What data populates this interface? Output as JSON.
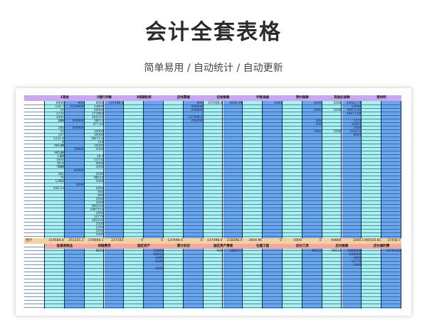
{
  "page": {
    "title": "会计全套表格",
    "subtitle": "简单易用 / 自动统计 / 自动更新"
  },
  "sheet": {
    "headers": [
      "1现金",
      "2银行存款",
      "3短期投资",
      "应收票据",
      "应收账款",
      "坏帐准备",
      "预付账款",
      "其他应收款",
      "原材料"
    ],
    "total_label": "合计",
    "totals": [
      "119584.8",
      "251331.1",
      "579006.1",
      "237193",
      "0",
      "0",
      "137498.4",
      "0",
      "137498.4",
      "218398.4",
      "2604.96",
      "0",
      "5000",
      "0",
      "40800",
      "1000",
      "1785545.81",
      "37458.7"
    ],
    "headers2": [
      "低值易耗品",
      "待摊费用",
      "固定资产",
      "累计折旧",
      "固定资产清理",
      "在建工程",
      "应付工资",
      "应付账款",
      "应付福利费"
    ],
    "col_values": {
      "c1": [
        "6000",
        "126.7",
        "",
        "3720",
        "",
        "200",
        "",
        "180",
        "",
        "",
        "1231.4",
        "8",
        "98531",
        "",
        "98533",
        "13.5",
        "1000",
        "",
        "7647",
        "",
        "",
        "",
        "126.7",
        "",
        "",
        "",
        "",
        "",
        "",
        "",
        "",
        "",
        "",
        ""
      ],
      "c2": [
        "",
        "",
        "20",
        "",
        "2000",
        "132",
        "",
        "",
        "50",
        "147",
        "",
        "",
        "30",
        "",
        "20",
        "80",
        "",
        "69.8",
        "500",
        "",
        "281",
        "76",
        "42",
        "",
        "206.53"
      ],
      "c3": [
        "900",
        "2500000",
        "",
        "",
        "",
        "200000",
        "",
        "300000",
        "",
        "",
        "",
        "",
        "",
        "20000",
        "",
        "",
        "",
        "",
        "",
        "80000",
        "",
        "",
        "",
        "3000"
      ],
      "c4": [
        "6000",
        "13800",
        "50900",
        "273860",
        "160375",
        "18672",
        "477.43",
        "",
        "10000",
        "10000",
        "18471.6",
        "144",
        "10000",
        "5500",
        "",
        "16.4",
        "13750",
        "4600",
        "3000",
        "",
        "2000",
        "98510",
        "5000",
        "",
        "2000",
        "660",
        "660",
        "2600",
        "2600",
        "883550",
        "1897155",
        "2400",
        "14770",
        "285250",
        "2500",
        "1200",
        "5500",
        "1000",
        "1200",
        "2251785",
        "200050",
        "206.13",
        "2172",
        "47974.68"
      ],
      "c5": [
        "137498.4"
      ],
      "c6": [
        "900",
        "300000",
        "200000",
        "",
        "137498.4",
        "200000"
      ],
      "c7": [
        "137498.4"
      ],
      "c8": [
        "2604.96"
      ],
      "c9": [
        "5000"
      ],
      "c10": [
        "2000",
        "",
        "2000",
        "",
        "",
        "500",
        "200",
        "",
        "1000"
      ],
      "c11": [
        "1000",
        "",
        "1000",
        "",
        "",
        "",
        "",
        "",
        "1000"
      ],
      "c12": [
        "23042.73",
        "14000",
        "76971.05",
        "18471.60",
        "",
        "1155",
        "10855",
        "2000",
        "351672",
        "9065"
      ]
    },
    "col_values2": {
      "c3": [
        "8001"
      ],
      "c4": [
        "13800",
        "40000",
        "2400",
        "2600",
        "",
        "1200"
      ],
      "c5": [
        "900"
      ],
      "c6": [
        "18823.7"
      ],
      "c9": [
        "98531"
      ],
      "c10": [
        "98533"
      ],
      "c11": [
        "1000000",
        "500000",
        "2600",
        "14775",
        "1000"
      ],
      "c12": [
        "13794.63"
      ]
    }
  }
}
